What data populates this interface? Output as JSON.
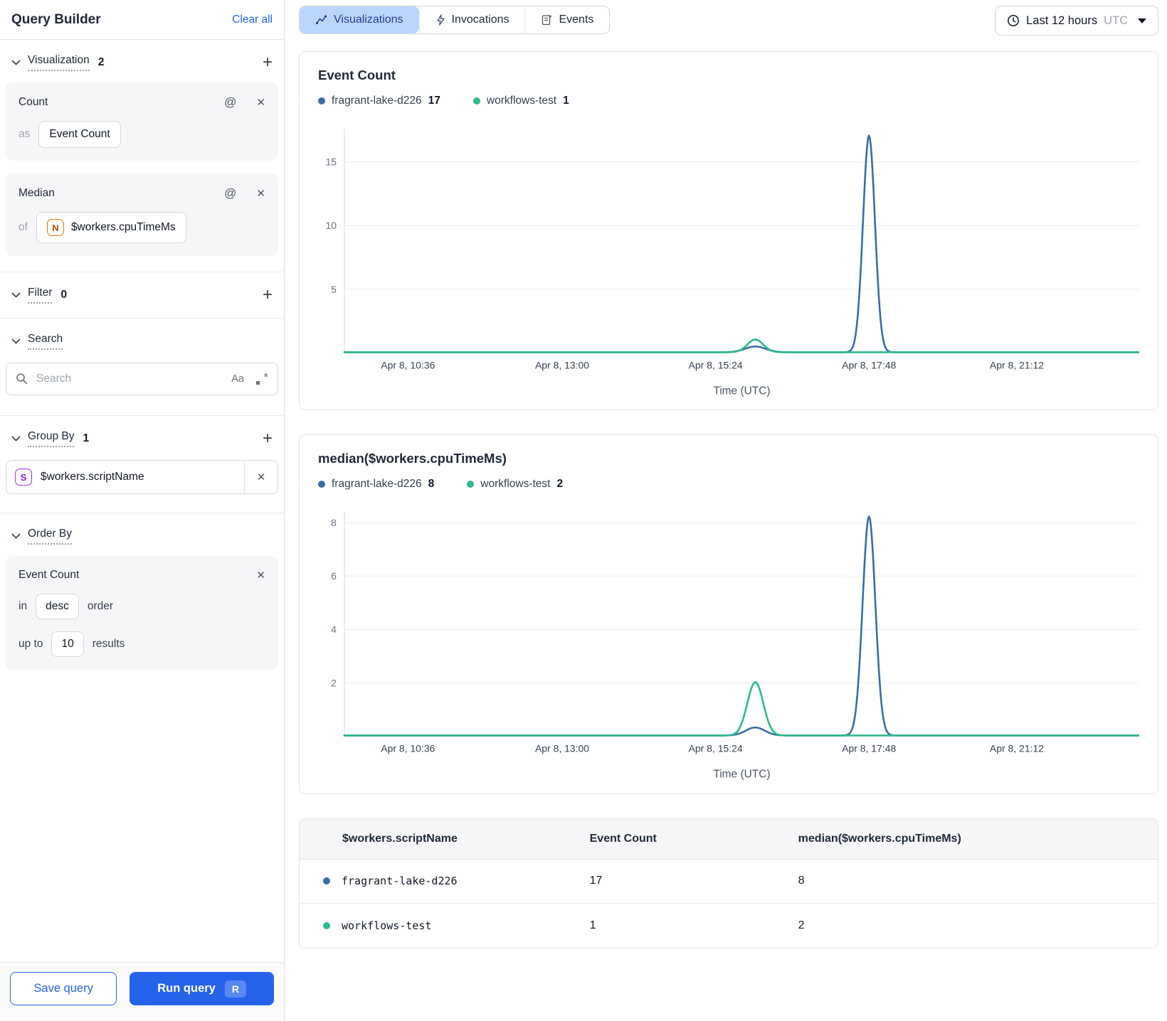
{
  "sidebar": {
    "title": "Query Builder",
    "clear_all_label": "Clear all",
    "icons": {
      "at": "@",
      "close": "✕",
      "plus": "+",
      "case": "Aa",
      "asterisk": "*"
    },
    "sections": {
      "visualization": {
        "label": "Visualization",
        "count": "2"
      },
      "filter": {
        "label": "Filter",
        "count": "0"
      },
      "search": {
        "label": "Search"
      },
      "group_by": {
        "label": "Group By",
        "count": "1"
      },
      "order_by": {
        "label": "Order By"
      }
    },
    "count_card": {
      "title": "Count",
      "prefix": "as",
      "value": "Event Count"
    },
    "median_card": {
      "title": "Median",
      "prefix": "of",
      "field_icon": "N",
      "value": "$workers.cpuTimeMs"
    },
    "search_input": {
      "placeholder": "Search"
    },
    "group_by_item": {
      "icon": "S",
      "value": "$workers.scriptName"
    },
    "order_card": {
      "title": "Event Count",
      "in_label": "in",
      "order_value": "desc",
      "order_suffix": "order",
      "limit_prefix": "up to",
      "limit_value": "10",
      "limit_suffix": "results"
    },
    "footer": {
      "save_label": "Save query",
      "run_label": "Run query",
      "run_shortcut": "R"
    }
  },
  "topbar": {
    "tabs": [
      {
        "label": "Visualizations",
        "active": true
      },
      {
        "label": "Invocations",
        "active": false
      },
      {
        "label": "Events",
        "active": false
      }
    ],
    "time_range": {
      "label": "Last 12 hours",
      "timezone": "UTC"
    }
  },
  "chart_data": [
    {
      "type": "line",
      "title": "Event Count",
      "xlabel": "Time (UTC)",
      "x_ticks": [
        "Apr 8, 10:36",
        "Apr 8, 13:00",
        "Apr 8, 15:24",
        "Apr 8, 17:48",
        "Apr 8, 21:12"
      ],
      "x_tick_fractions": [
        0.08,
        0.274,
        0.467,
        0.66,
        0.846
      ],
      "ylim": [
        0,
        17.6
      ],
      "y_ticks": [
        5,
        10,
        15
      ],
      "grid": true,
      "legend_position": "top",
      "series": [
        {
          "name": "fragrant-lake-d226",
          "legend_value": "17",
          "color": "#3a6da4",
          "baseline": 0,
          "peaks": [
            {
              "center": 0.517,
              "height": 0.45,
              "width": 0.013
            },
            {
              "center": 0.66,
              "height": 17,
              "width": 0.0075
            }
          ]
        },
        {
          "name": "workflows-test",
          "legend_value": "1",
          "color": "#2eb98a",
          "baseline": 0,
          "peaks": [
            {
              "center": 0.517,
              "height": 1,
              "width": 0.01
            }
          ]
        }
      ]
    },
    {
      "type": "line",
      "title": "median($workers.cpuTimeMs)",
      "xlabel": "Time (UTC)",
      "x_ticks": [
        "Apr 8, 10:36",
        "Apr 8, 13:00",
        "Apr 8, 15:24",
        "Apr 8, 17:48",
        "Apr 8, 21:12"
      ],
      "x_tick_fractions": [
        0.08,
        0.274,
        0.467,
        0.66,
        0.846
      ],
      "ylim": [
        0,
        8.4
      ],
      "y_ticks": [
        2,
        4,
        6,
        8
      ],
      "grid": true,
      "legend_position": "top",
      "series": [
        {
          "name": "fragrant-lake-d226",
          "legend_value": "8",
          "color": "#3a6da4",
          "baseline": 0,
          "peaks": [
            {
              "center": 0.517,
              "height": 0.3,
              "width": 0.012
            },
            {
              "center": 0.66,
              "height": 8.2,
              "width": 0.008
            }
          ]
        },
        {
          "name": "workflows-test",
          "legend_value": "2",
          "color": "#2eb98a",
          "baseline": 0,
          "peaks": [
            {
              "center": 0.517,
              "height": 2,
              "width": 0.01
            }
          ]
        }
      ]
    }
  ],
  "table": {
    "columns": [
      "$workers.scriptName",
      "Event Count",
      "median($workers.cpuTimeMs)"
    ],
    "rows": [
      {
        "name": "fragrant-lake-d226",
        "event_count": "17",
        "median": "8",
        "color": "#3a6da4"
      },
      {
        "name": "workflows-test",
        "event_count": "1",
        "median": "2",
        "color": "#2eb98a"
      }
    ]
  },
  "colors": {
    "series_blue": "#3a6da4",
    "series_green": "#2eb98a",
    "accent": "#2563eb",
    "active_tab_bg": "#bcd6fb"
  }
}
